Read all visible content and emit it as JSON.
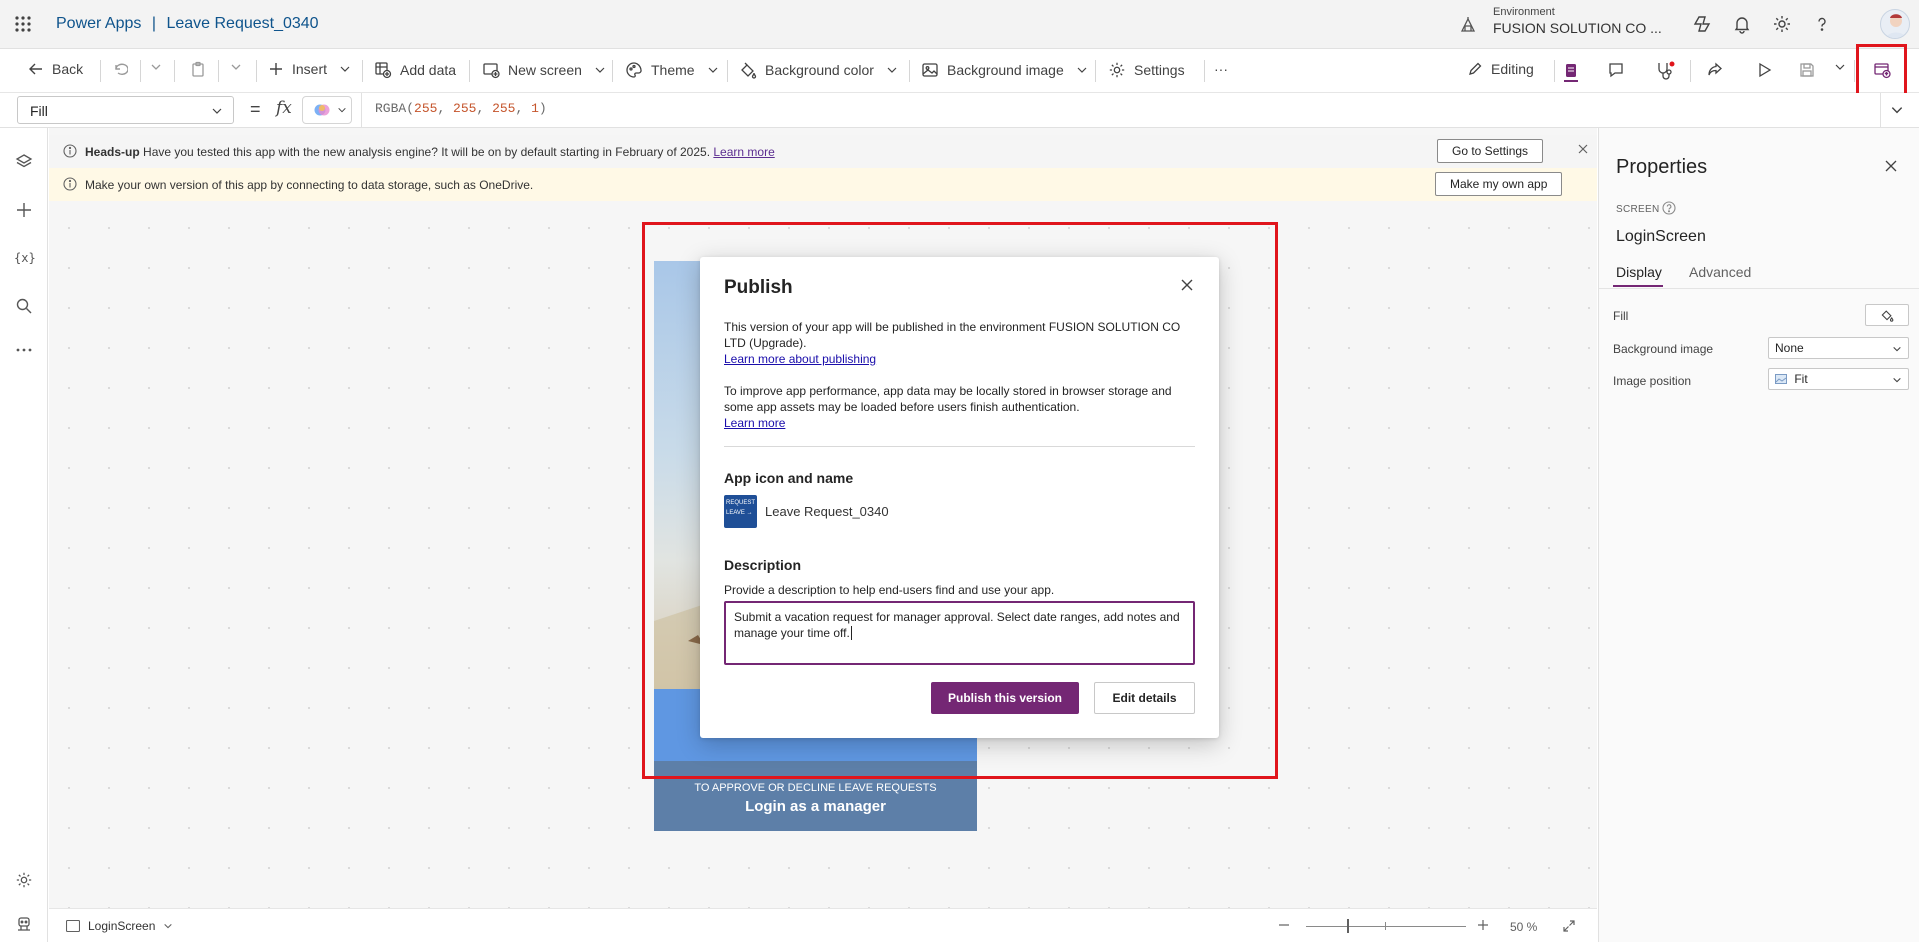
{
  "header": {
    "title_app": "Power Apps",
    "title_sep": "|",
    "title_name": "Leave Request_0340",
    "env_label": "Environment",
    "env_name": "FUSION SOLUTION CO ..."
  },
  "commands": {
    "back": "Back",
    "insert": "Insert",
    "add_data": "Add data",
    "new_screen": "New screen",
    "theme": "Theme",
    "background_color": "Background color",
    "background_image": "Background image",
    "settings": "Settings",
    "more": "···",
    "editing": "Editing"
  },
  "formula": {
    "property": "Fill",
    "equals": "=",
    "fx": "fx",
    "fn_name": "RGBA",
    "args": [
      "255",
      "255",
      "255",
      "1"
    ]
  },
  "notices": {
    "headsup_bold": "Heads-up",
    "headsup_text": "Have you tested this app with the new analysis engine? It will be on by default starting in February of 2025.",
    "headsup_link": "Learn more",
    "headsup_button": "Go to Settings",
    "storage_text": "Make your own version of this app by connecting to data storage, such as OneDrive.",
    "storage_button": "Make my own app"
  },
  "preview": {
    "manager_sub": "TO APPROVE OR DECLINE LEAVE REQUESTS",
    "manager_main": "Login as a manager"
  },
  "dialog": {
    "title": "Publish",
    "env_text": "This version of your app will be published in the environment FUSION SOLUTION CO LTD (Upgrade).",
    "env_link": "Learn more about publishing",
    "perf_text": "To improve app performance, app data may be locally stored in browser storage and some app assets may be loaded before users finish authentication.",
    "perf_link": "Learn more",
    "icon_heading": "App icon and name",
    "icon_text_line1": "REQUEST",
    "icon_text_line2": "LEAVE →",
    "app_name": "Leave Request_0340",
    "desc_heading": "Description",
    "desc_hint": "Provide a description to help end-users find and use your app.",
    "desc_value": "Submit a vacation request for manager approval. Select date ranges, add notes and manage your time off.",
    "publish_button": "Publish this version",
    "edit_button": "Edit details"
  },
  "properties": {
    "title": "Properties",
    "kind": "SCREEN",
    "name": "LoginScreen",
    "tabs": [
      "Display",
      "Advanced"
    ],
    "fill_label": "Fill",
    "bg_image_label": "Background image",
    "bg_image_value": "None",
    "image_position_label": "Image position",
    "image_position_value": "Fit"
  },
  "status": {
    "screen": "LoginScreen",
    "zoom": "50 %"
  },
  "colors": {
    "accent": "#742774",
    "highlight": "#e0151c",
    "brand_blue": "#0f548c"
  }
}
